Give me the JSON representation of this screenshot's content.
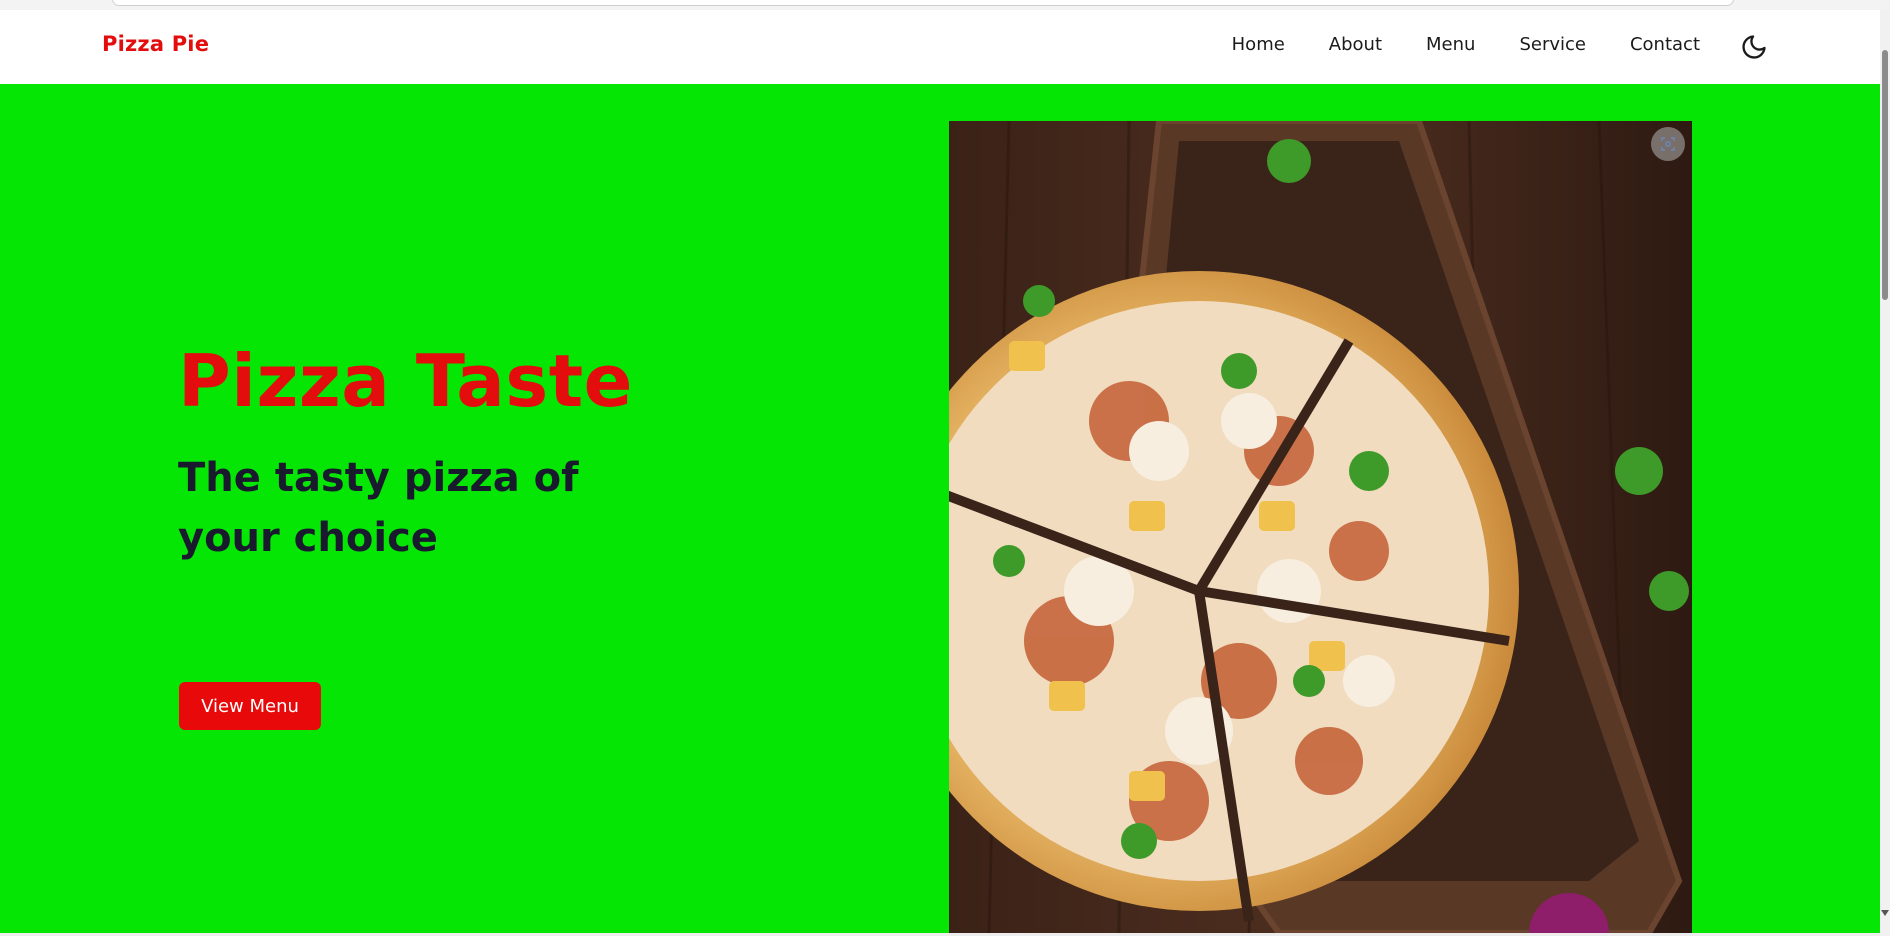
{
  "navbar": {
    "brand": "Pizza Pie",
    "links": [
      "Home",
      "About",
      "Menu",
      "Service",
      "Contact"
    ],
    "theme_icon": "moon-icon"
  },
  "hero": {
    "title": "Pizza Taste",
    "subtitle": "The tasty pizza of your choice",
    "cta_label": "View Menu",
    "image_icon": "lens-search-icon"
  },
  "colors": {
    "brand_red": "#e30d0d",
    "hero_green": "#05e605",
    "button_red": "#e80a0a",
    "text_dark": "#1a1a2e"
  }
}
